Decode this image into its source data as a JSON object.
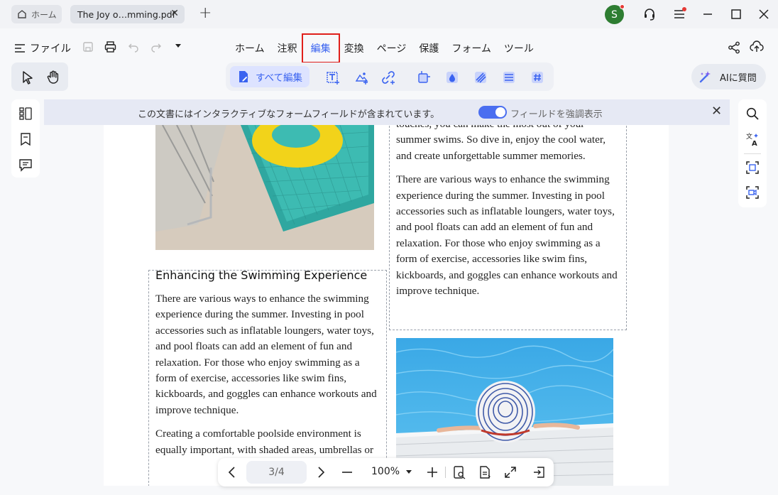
{
  "tabs": {
    "home_label": "ホーム",
    "doc_label": "The Joy o…mming.pdf"
  },
  "avatar": {
    "initial": "S"
  },
  "menu": {
    "file_label": "ファイル",
    "items": [
      "ホーム",
      "注釈",
      "編集",
      "変換",
      "ページ",
      "保護",
      "フォーム",
      "ツール"
    ],
    "active": "編集"
  },
  "toolbar": {
    "edit_all_label": "すべて編集",
    "ai_label": "AIに質問"
  },
  "notice": {
    "message": "この文書にはインタラクティブなフォームフィールドが含まれています。",
    "toggle_label": "フィールドを強調表示"
  },
  "document": {
    "heading": "Enhancing the Swimming Experience",
    "left_paragraph_1": "There are various ways to enhance the swimming experience during the summer. Investing in pool accessories such as inflatable loungers, water toys, and pool floats can add an element of fun and relaxation. For those who enjoy swimming as a form of exercise, accessories like swim fins, kickboards, and goggles can enhance workouts and improve technique.",
    "left_paragraph_2": "Creating a comfortable poolside environment is equally important, with shaded areas, umbrellas or",
    "right_paragraph_0": "touches, you can make the most out of your summer swims. So dive in, enjoy the cool water, and create unforgettable summer memories.",
    "right_paragraph_1": "There are various ways to enhance the swimming experience during the summer. Investing in pool accessories such as inflatable loungers, water toys, and pool floats can add an element of fun and relaxation. For those who enjoy swimming as a form of exercise, accessories like swim fins, kickboards, and goggles can enhance workouts and improve technique."
  },
  "navigation": {
    "page_indicator": "3/4",
    "zoom": "100%"
  },
  "colors": {
    "accent": "#3a63f0",
    "highlight_box": "#e0201b",
    "avatar_bg": "#2e7d32"
  }
}
